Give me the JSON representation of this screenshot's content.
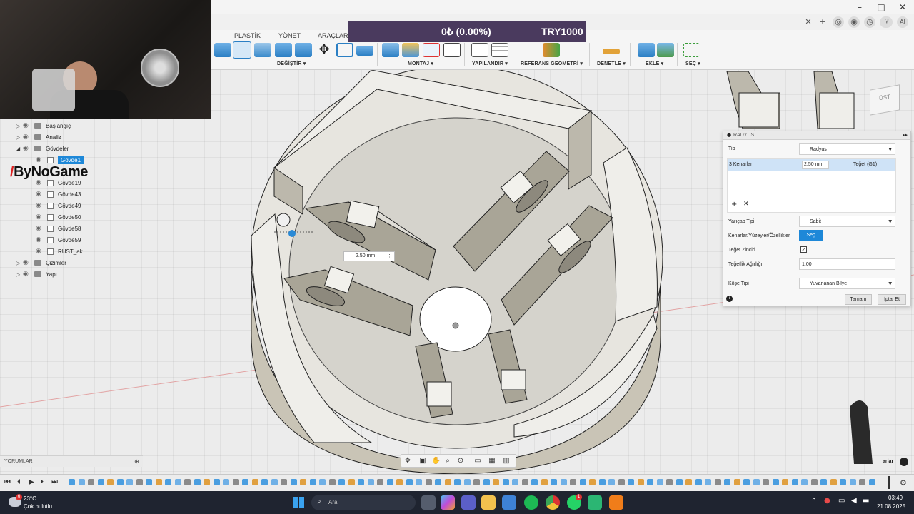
{
  "price_banner": {
    "left": "0₺ (0.00%)",
    "right": "TRY1000"
  },
  "ribbon_tabs": [
    "PLASTİK",
    "YÖNET",
    "ARAÇLAR"
  ],
  "toolbar_groups": [
    "DEĞİŞTİR ▾",
    "MONTAJ ▾",
    "YAPILANDIR ▾",
    "REFERANS GEOMETRİ ▾",
    "DENETLE ▾",
    "EKLE ▾",
    "SEÇ ▾"
  ],
  "browser": {
    "items": [
      {
        "label": "Başlangıç",
        "type": "folder",
        "expander": "▷"
      },
      {
        "label": "Analiz",
        "type": "folder",
        "expander": "▷"
      },
      {
        "label": "Gövdeler",
        "type": "folder",
        "expander": "◢"
      },
      {
        "label": "Gövde1",
        "type": "body",
        "selected": true
      },
      {
        "label": "Gövde19",
        "type": "body"
      },
      {
        "label": "Gövde43",
        "type": "body"
      },
      {
        "label": "Gövde49",
        "type": "body"
      },
      {
        "label": "Gövde50",
        "type": "body"
      },
      {
        "label": "Gövde58",
        "type": "body"
      },
      {
        "label": "Gövde59",
        "type": "body"
      },
      {
        "label": "RUST_ak",
        "type": "body"
      },
      {
        "label": "Çizimler",
        "type": "folder",
        "expander": "▷"
      },
      {
        "label": "Yapı",
        "type": "folder",
        "expander": "▷"
      }
    ]
  },
  "watermark": "ByNoGame",
  "viewcube_label": "ÜST",
  "dimension_input": "2.50 mm",
  "radius_panel": {
    "title": "RADYUS",
    "type_label": "Tip",
    "type_value": "Radyus",
    "edges_label": "3 Kenarlar",
    "edges_value": "2.50 mm",
    "edges_continuity": "Teğet (G1)",
    "radius_type_label": "Yarıçap Tipi",
    "radius_type_value": "Sabit",
    "select_label": "Kenarlar/Yüzeyler/Özellikler",
    "select_button": "Seç",
    "tangent_chain_label": "Teğet Zinciri",
    "tangent_weight_label": "Teğetlik Ağırlığı",
    "tangent_weight_value": "1.00",
    "corner_type_label": "Köşe Tipi",
    "corner_type_value": "Yuvarlanan Bilye",
    "ok_button": "Tamam",
    "cancel_button": "İptal Et"
  },
  "comments_label": "YORUMLAR",
  "canvas_right_label": "arlar",
  "taskbar": {
    "weather_badge": "6",
    "weather_temp": "23°C",
    "weather_desc": "Çok bulutlu",
    "search_placeholder": "Ara",
    "time": "03:49",
    "date": "21.08.2025",
    "whatsapp_badge": "1"
  },
  "colors": {
    "banner": "#4a3a5e",
    "accent_blue": "#1e88d8",
    "selection": "#cfe3f7",
    "taskbar": "#1f2430"
  }
}
